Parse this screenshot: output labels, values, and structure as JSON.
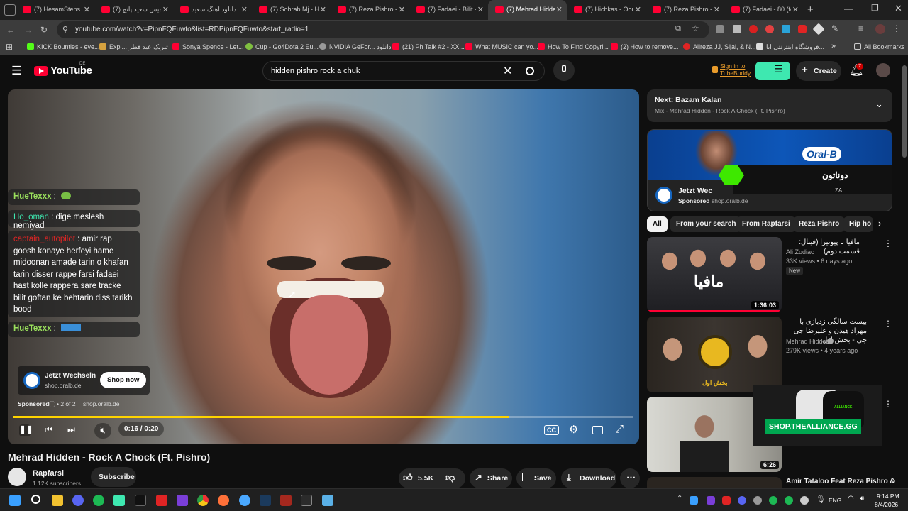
{
  "browser": {
    "tabs": [
      {
        "title": "(7) HesamSteps D"
      },
      {
        "title": "دیس سعید پانچ (7)"
      },
      {
        "title": "دانلود آهنگ سعید"
      },
      {
        "title": "(7) Sohrab Mj - H"
      },
      {
        "title": "(7) Reza Pishro -"
      },
      {
        "title": "(7) Fadaei - Bilit -"
      },
      {
        "title": "(7) Mehrad Hidde"
      },
      {
        "title": "(7) Hichkas - Oon"
      },
      {
        "title": "(7) Reza Pishro -"
      },
      {
        "title": "(7) Fadaei - 80 (fe"
      }
    ],
    "url": "youtube.com/watch?v=PipnFQFuwto&list=RDPipnFQFuwto&start_radio=1",
    "bookmarks": [
      "KICK Bounties - eve...",
      "Expl... تبریک عید فطر",
      "Sonya Spence - Let...",
      "Cup - Go4Dota 2 Eu...",
      "NVIDIA GeFor... دانلود",
      "(21) Ph Talk #2 - XX...",
      "What MUSIC can yo...",
      "How To Find Copyri...",
      "(2) How to remove...",
      "Alireza JJ, Sijal, & N...",
      "فروشگاه اینترنتی ابا...",
      "All Bookmarks"
    ]
  },
  "youtube": {
    "logo": "YouTube",
    "region": "DE",
    "search_query": "hidden pishro rock a chuk",
    "signin_line1": "Sign in to",
    "signin_line2": "TubeBuddy",
    "create_label": "Create",
    "notif_count": "7"
  },
  "player": {
    "chat": [
      {
        "user": "HueTexxx",
        "sep": " :",
        "msg": ""
      },
      {
        "user": "Ho_oman",
        "sep": " :",
        "msg": "dige meslesh nemiyad"
      },
      {
        "user": "captain_autopilot",
        "sep": " :",
        "msg": "amir rap goosh konaye herfeyi hame midoonan amade tarin o khafan tarin disser rappe farsi fadaei hast kolle rappera sare tracke bilit goftan ke behtarin diss tarikh bood"
      },
      {
        "user": "HueTexxx",
        "sep": " :",
        "msg": ""
      }
    ],
    "ad_name": "Jetzt Wechseln",
    "ad_domain": "shop.oralb.de",
    "shop_now": "Shop now",
    "sponsored": "Sponsored",
    "ad_count": "• 2 of 2",
    "ad_site": "shop.oralb.de",
    "time": "0:16 / 0:20",
    "progress": 0.8
  },
  "video": {
    "title": "Mehrad Hidden - Rock A Chock (Ft. Pishro)",
    "channel": "Rapfarsi",
    "subscribers": "1.12K subscribers",
    "subscribe": "Subscribe",
    "likes": "5.5K",
    "share": "Share",
    "save": "Save",
    "download": "Download"
  },
  "sidebar": {
    "next_label": "Next: Bazam Kalan",
    "mix_label": "Mix - Mehrad Hidden - Rock A Chock (Ft. Pishro)",
    "ad_brand": "Oral-B",
    "ad_persian": "دوناتون",
    "ad_title": "Jetzt Wec",
    "ad_sponsored": "Sponsored",
    "ad_site": "shop.oralb.de",
    "ad_letters": "ZA",
    "chips": [
      "All",
      "From your search",
      "From Rapfarsi",
      "Reza Pishro",
      "Hip ho"
    ],
    "videos": [
      {
        "title": "مافیا با پیوتیرا (فینال: قسمت دوم)",
        "channel": "Ali Zodiac",
        "meta": "33K views • 6 days ago",
        "badge": "New",
        "duration": "1:36:03",
        "thumb_text": "مافیا"
      },
      {
        "title": "بیست سالگی زدبازی با مهراد هیدن و علیرضا جی جی - بخش اول",
        "channel": "Mehrad Hidden",
        "meta": "279K views • 4 years ago",
        "badge": "",
        "duration": "",
        "thumb_text": "بخش اول"
      },
      {
        "title": "",
        "channel": "",
        "meta": "",
        "badge": "",
        "duration": "6:26",
        "thumb_text": ""
      },
      {
        "title": "Amir Tataloo Feat Reza Pishro &",
        "channel": "",
        "meta": "",
        "badge": "",
        "duration": "",
        "thumb_text": ""
      }
    ],
    "overlay_ad": "SHOP.THEALLIANCE.GG",
    "overlay_brand": "ALLIANCE"
  },
  "taskbar": {
    "lang": "ENG",
    "time": "9:14 PM",
    "date": "8/4/2026"
  },
  "colors": {
    "yt_red": "#ff0033",
    "progress": "#ffd400",
    "bg": "#0f0f0f",
    "chip": "#272727",
    "ad_green": "#00a650"
  }
}
